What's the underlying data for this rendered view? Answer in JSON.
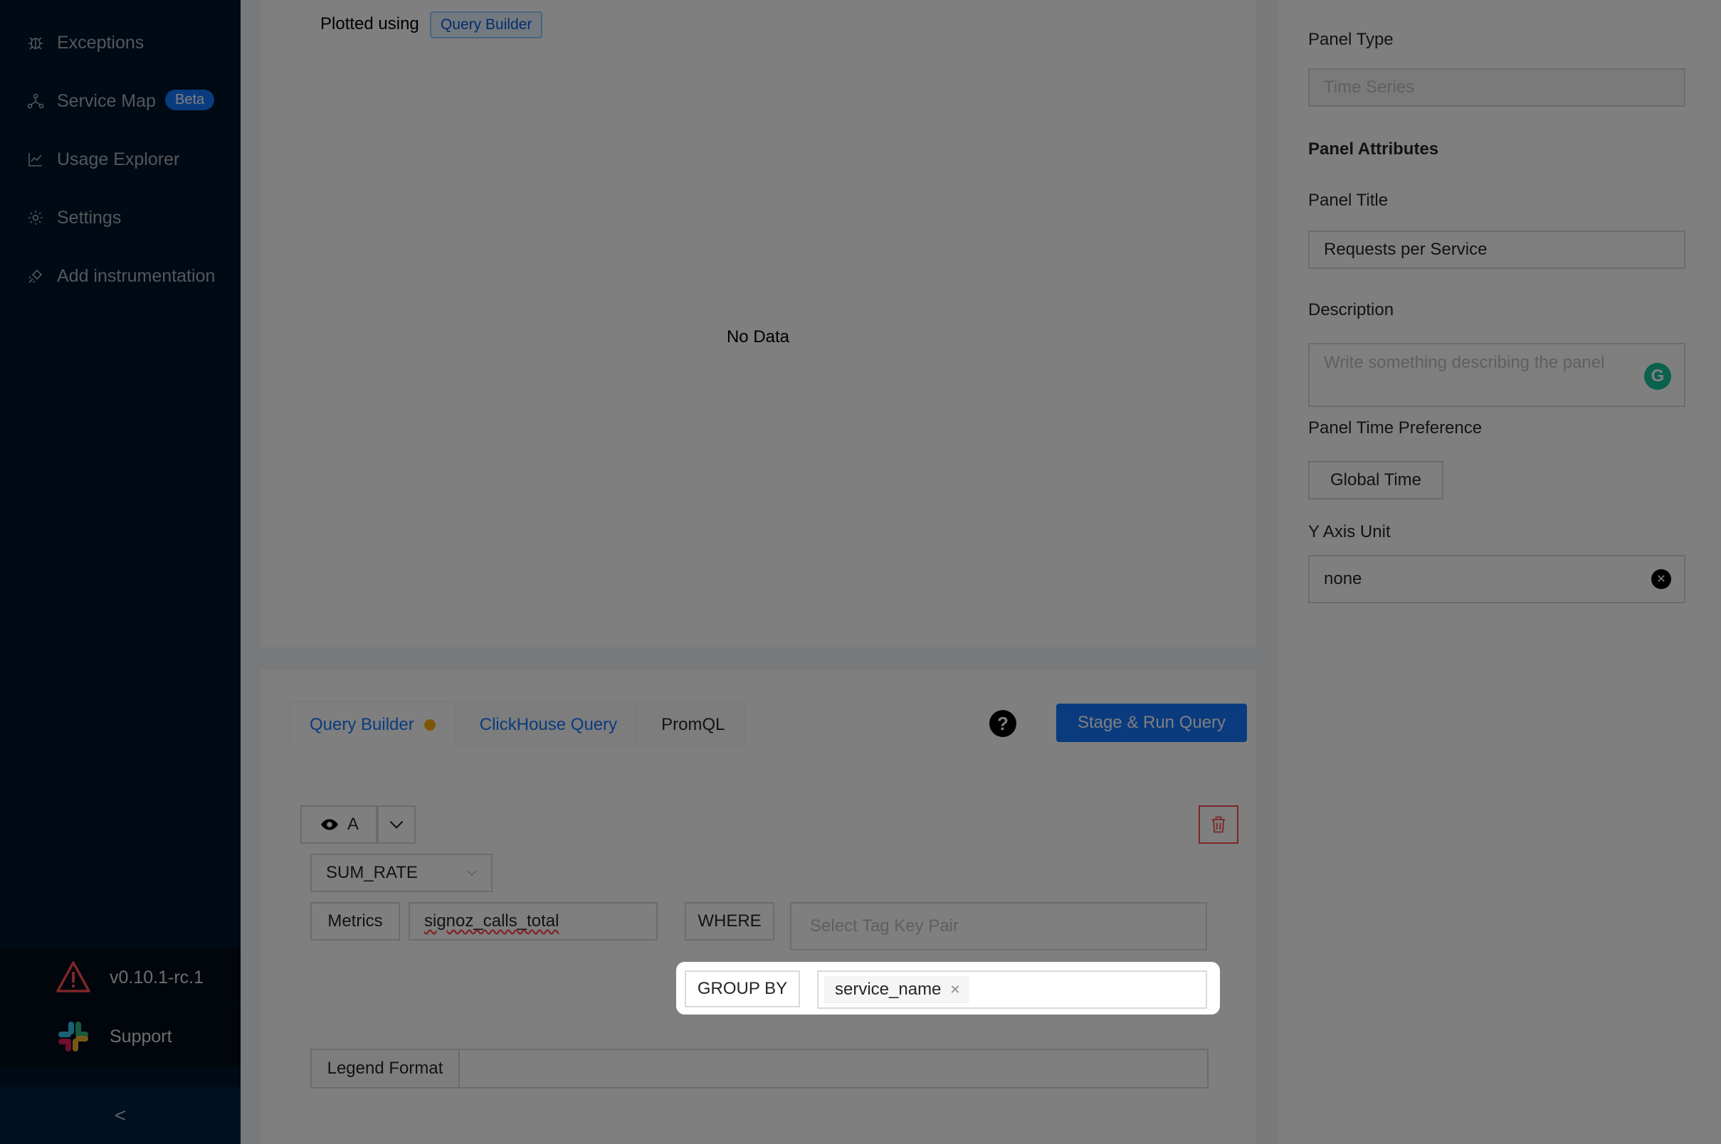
{
  "sidebar": {
    "items": [
      {
        "label": "Exceptions",
        "icon": "bug-icon"
      },
      {
        "label": "Service Map",
        "icon": "deployment-unit-icon",
        "badge": "Beta"
      },
      {
        "label": "Usage Explorer",
        "icon": "line-chart-icon"
      },
      {
        "label": "Settings",
        "icon": "gear-icon"
      },
      {
        "label": "Add instrumentation",
        "icon": "api-icon"
      }
    ],
    "version": "v0.10.1-rc.1",
    "support": "Support",
    "collapse": "<"
  },
  "chart": {
    "plotted_using": "Plotted using",
    "plotted_tag": "Query Builder",
    "empty": "No Data"
  },
  "query": {
    "tabs": [
      {
        "label": "Query Builder"
      },
      {
        "label": "ClickHouse Query"
      },
      {
        "label": "PromQL"
      }
    ],
    "help": "?",
    "run_button": "Stage & Run Query",
    "query_name": "A",
    "aggregation": "SUM_RATE",
    "metrics_label": "Metrics",
    "metric_name": "signoz_calls_total",
    "where_label": "WHERE",
    "tag_placeholder": "Select Tag Key Pair",
    "group_by_label": "GROUP BY",
    "group_by_value": "service_name",
    "legend_label": "Legend Format",
    "legend_value": ""
  },
  "panel": {
    "type_label": "Panel Type",
    "type_value": "Time Series",
    "attributes_heading": "Panel Attributes",
    "title_label": "Panel Title",
    "title_value": "Requests per Service",
    "description_label": "Description",
    "description_placeholder": "Write something describing the  panel",
    "time_pref_label": "Panel Time Preference",
    "time_pref_value": "Global Time",
    "y_axis_label": "Y Axis Unit",
    "y_axis_value": "none"
  },
  "colors": {
    "sidebar_bg": "#001529",
    "primary": "#1677ff",
    "warning": "#faad14",
    "danger": "#ff4d4f"
  }
}
